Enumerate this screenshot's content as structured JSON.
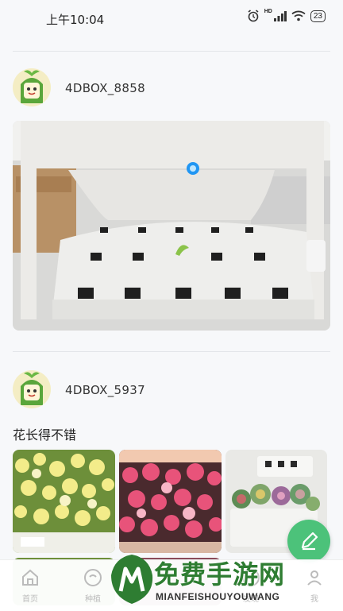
{
  "status_bar": {
    "time": "上午10:04",
    "battery": "23",
    "hd": "HD"
  },
  "posts": [
    {
      "username": "4DBOX_8858",
      "text": ""
    },
    {
      "username": "4DBOX_5937",
      "text": "花长得不错"
    }
  ],
  "bottom_nav": {
    "items": [
      {
        "label": "首页",
        "icon": "home-icon"
      },
      {
        "label": "种植",
        "icon": "plant-icon"
      },
      {
        "label": "发现",
        "icon": "discover-icon"
      },
      {
        "label": "我",
        "icon": "profile-icon"
      }
    ]
  },
  "fab": {
    "icon": "edit-pen-icon"
  },
  "watermark": {
    "title": "免费手游网",
    "subtitle": "MIANFEISHOUYOUWANG"
  },
  "colors": {
    "accent": "#4cc27a",
    "background": "#f7f8fa",
    "watermark_green": "#2e7d32"
  }
}
